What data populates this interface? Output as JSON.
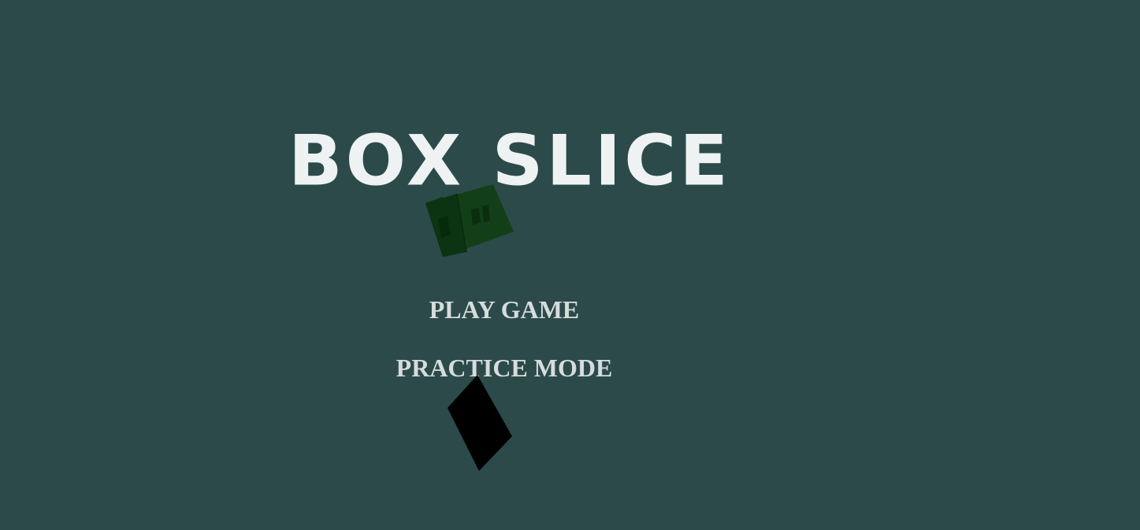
{
  "game": {
    "title": "BOX SLICE",
    "background_color": "#2c4a4a",
    "title_color": "#eef2f2",
    "menu_text_color": "#d6dcdc"
  },
  "menu": {
    "play_label": "PLAY GAME",
    "practice_label": "PRACTICE MODE"
  },
  "objects": {
    "cube_color": "#0f3d14",
    "slab_color": "#000000"
  }
}
